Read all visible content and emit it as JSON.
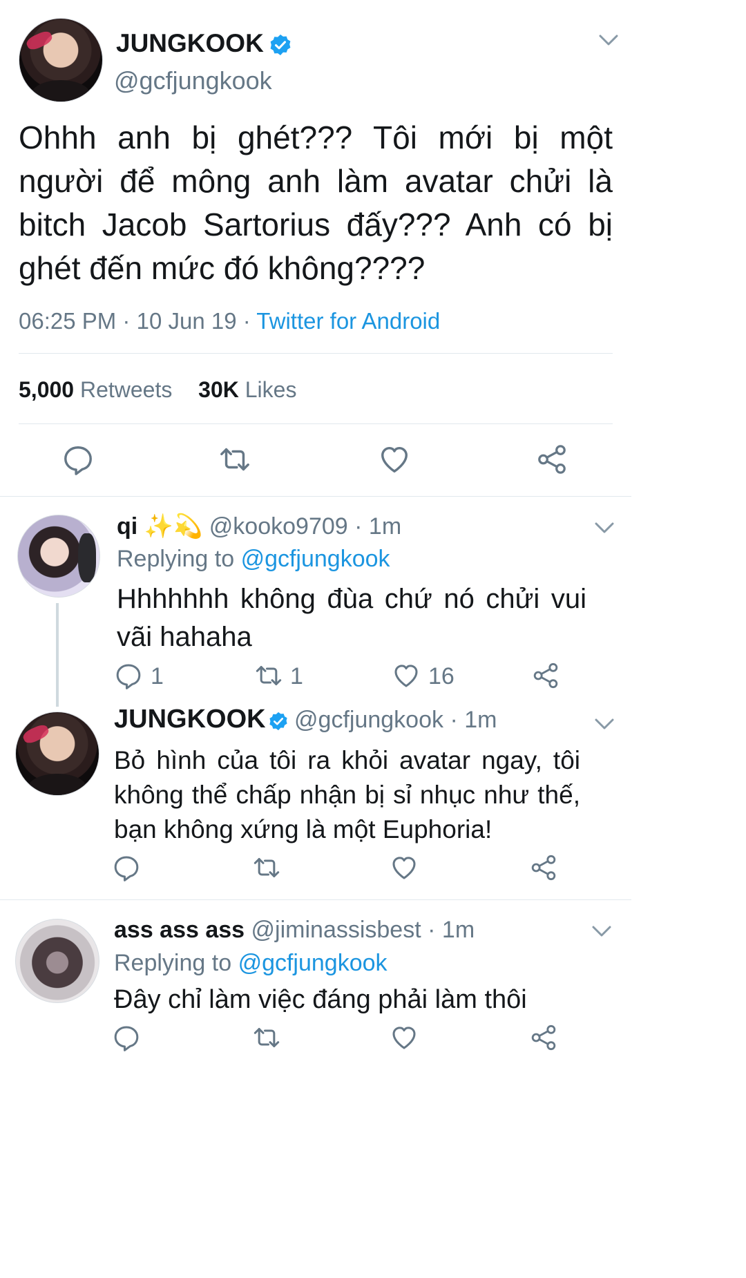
{
  "main_tweet": {
    "display_name": "JUNGKOOK",
    "handle": "@gcfjungkook",
    "text_lines": [
      "Ohhh anh bị ghét??? Tôi mới bị một",
      "người để mông anh làm avatar chửi là",
      "bitch Jacob Sartorius đấy??? Anh có bị",
      "ghét đến mức đó không????"
    ],
    "time": "06:25 PM",
    "date": "10 Jun 19",
    "source": "Twitter for Android",
    "retweets_count": "5,000",
    "retweets_label": "Retweets",
    "likes_count": "30K",
    "likes_label": "Likes"
  },
  "replies": [
    {
      "display_name": "qi",
      "emoji": "✨💫",
      "handle": "@kooko9709",
      "age": "1m",
      "replying_prefix": "Replying to",
      "replying_handle": "@gcfjungkook",
      "text_lines": [
        "Hhhhhhh không đùa chứ nó chửi vui",
        "vãi hahaha"
      ],
      "retweets": "1",
      "reply_count": "1",
      "likes": "16"
    },
    {
      "display_name": "JUNGKOOK",
      "handle": "@gcfjungkook",
      "age": "1m",
      "text_lines": [
        "Bỏ hình của tôi ra khỏi avatar ngay, tôi",
        "không thể chấp nhận bị sỉ nhục như thế,",
        "bạn không xứng là một Euphoria!"
      ]
    },
    {
      "display_name": "ass ass ass",
      "handle": "@jiminassisbest",
      "age": "1m",
      "replying_prefix": "Replying to",
      "replying_handle": "@gcfjungkook",
      "text_lines": [
        "Đây chỉ làm việc đáng phải làm thôi"
      ]
    }
  ],
  "icons": {
    "verified": "verified-badge-icon",
    "reply": "reply-icon",
    "retweet": "retweet-icon",
    "like": "heart-icon",
    "share": "share-icon",
    "chevron": "chevron-down-icon"
  },
  "colors": {
    "accent": "#1b95e0",
    "muted": "#657786",
    "text": "#14171a",
    "divider": "#e1e8ed"
  }
}
